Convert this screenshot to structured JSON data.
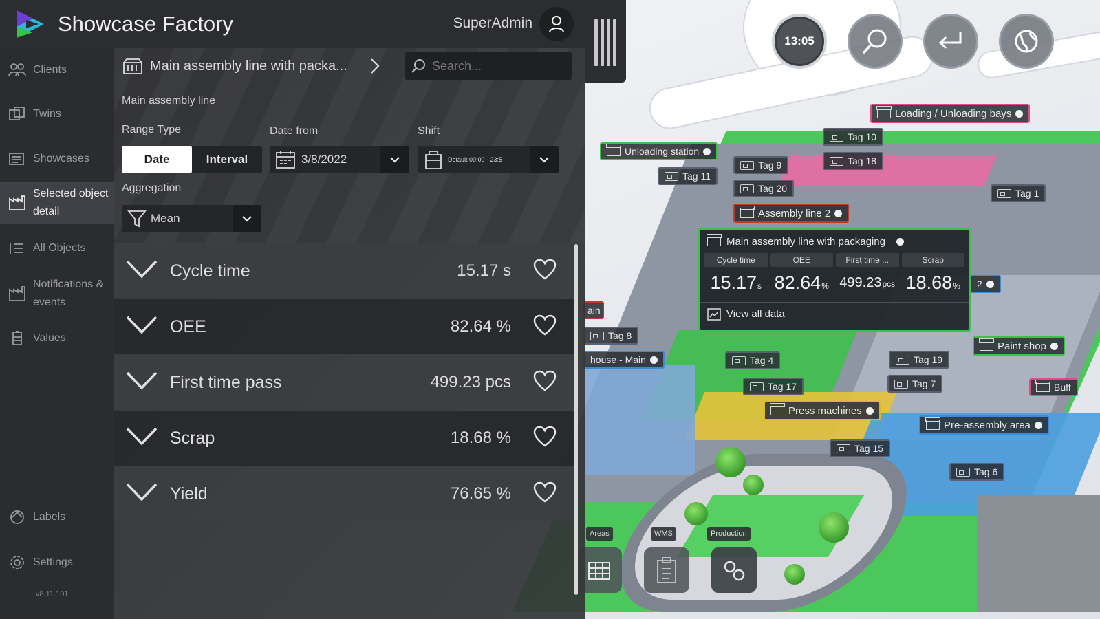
{
  "app": {
    "title": "Showcase Factory",
    "user": "SuperAdmin",
    "version": "v8.11.101"
  },
  "sidebar": {
    "items": [
      {
        "label": "Clients",
        "icon": "clients-icon"
      },
      {
        "label": "Twins",
        "icon": "twins-icon"
      },
      {
        "label": "Showcases",
        "icon": "showcases-icon"
      },
      {
        "label": "Selected object detail",
        "icon": "object-detail-icon",
        "active": true
      },
      {
        "label": "All Objects",
        "icon": "list-icon"
      },
      {
        "label": "Notifications & events",
        "icon": "notifications-icon"
      },
      {
        "label": "Values",
        "icon": "values-icon"
      }
    ],
    "bottom": [
      {
        "label": "Labels",
        "icon": "labels-icon"
      },
      {
        "label": "Settings",
        "icon": "gear-icon"
      }
    ]
  },
  "panel": {
    "breadcrumb": "Main assembly line with packa...",
    "search_placeholder": "Search...",
    "object_name": "Main assembly line",
    "range_type_label": "Range Type",
    "range_options": [
      "Date",
      "Interval"
    ],
    "range_selected": "Date",
    "date_from_label": "Date from",
    "date_from_value": "3/8/2022",
    "shift_label": "Shift",
    "shift_value": "Default 00:00 - 23:5",
    "aggregation_label": "Aggregation",
    "aggregation_value": "Mean",
    "kpis": [
      {
        "name": "Cycle time",
        "value": "15.17 s"
      },
      {
        "name": "OEE",
        "value": "82.64 %"
      },
      {
        "name": "First time pass",
        "value": "499.23 pcs"
      },
      {
        "name": "Scrap",
        "value": "18.68 %"
      },
      {
        "name": "Yield",
        "value": "76.65 %"
      }
    ]
  },
  "map": {
    "clock": "13:05",
    "tags": {
      "loading": "Loading / Unloading bays",
      "unloading": "Unloading station",
      "tag10": "Tag 10",
      "tag9": "Tag 9",
      "tag18": "Tag 18",
      "tag11": "Tag 11",
      "tag20": "Tag 20",
      "tag1": "Tag 1",
      "assembly2": "Assembly line 2",
      "tag8": "Tag 8",
      "warehouse": "house - Main",
      "tag4": "Tag 4",
      "tag17": "Tag 17",
      "tag19": "Tag 19",
      "tag7": "Tag 7",
      "paint": "Paint shop",
      "press": "Press machines",
      "preassembly": "Pre-assembly area",
      "tag15": "Tag 15",
      "tag6": "Tag 6",
      "buffer": "Buff",
      "ain": "ain",
      "two": "2"
    },
    "card": {
      "title": "Main assembly line with packaging",
      "metrics": [
        {
          "header": "Cycle time",
          "value": "15.17",
          "unit": "s"
        },
        {
          "header": "OEE",
          "value": "82.64",
          "unit": "%"
        },
        {
          "header": "First time ...",
          "value": "499.23",
          "unit": "pcs"
        },
        {
          "header": "Scrap",
          "value": "18.68",
          "unit": "%"
        }
      ],
      "view_all": "View all data"
    },
    "modes": [
      {
        "label": "Areas",
        "icon": "grid-icon"
      },
      {
        "label": "WMS",
        "icon": "clipboard-icon"
      },
      {
        "label": "Production",
        "icon": "gears-icon"
      }
    ]
  },
  "colors": {
    "accent_green": "#3ec04f",
    "panel_bg": "#2e2f32",
    "sidebar_bg": "#2b2c2f"
  }
}
